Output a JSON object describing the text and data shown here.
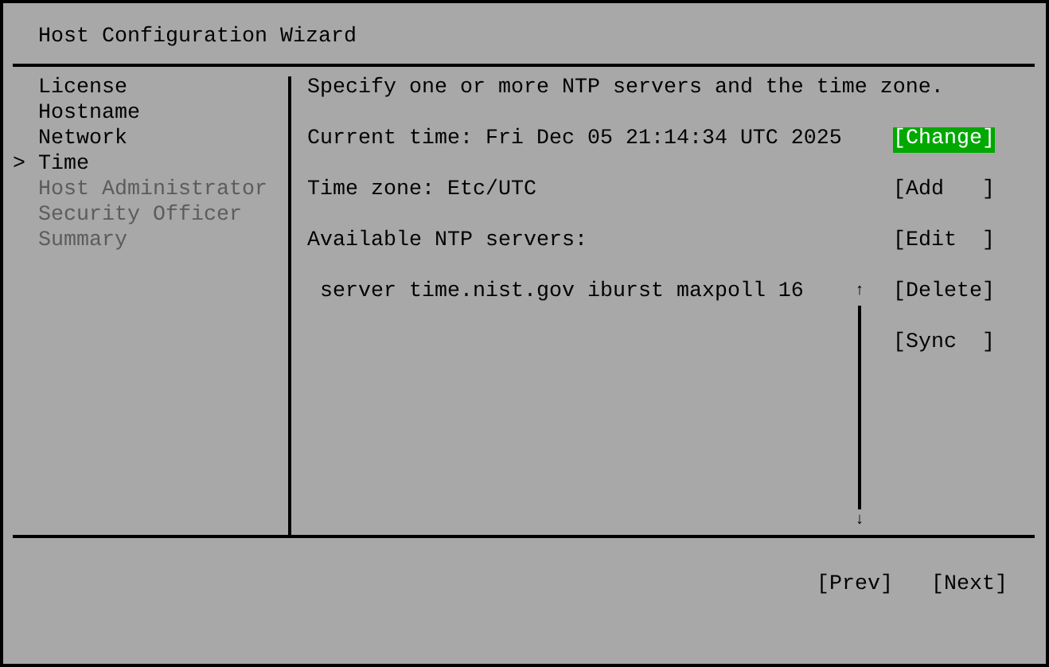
{
  "window": {
    "title": "Host Configuration Wizard"
  },
  "sidebar": {
    "marker": ">",
    "items": [
      {
        "label": "License",
        "selected": false,
        "disabled": false
      },
      {
        "label": "Hostname",
        "selected": false,
        "disabled": false
      },
      {
        "label": "Network",
        "selected": false,
        "disabled": false
      },
      {
        "label": "Time",
        "selected": true,
        "disabled": false
      },
      {
        "label": "Host Administrator",
        "selected": false,
        "disabled": true
      },
      {
        "label": "Security Officer",
        "selected": false,
        "disabled": true
      },
      {
        "label": "Summary",
        "selected": false,
        "disabled": true
      }
    ]
  },
  "content": {
    "description": "Specify one or more NTP servers and the time zone.",
    "current_time": "Current time: Fri Dec 05 21:14:34 UTC 2025",
    "time_zone": "Time zone: Etc/UTC",
    "servers_label": "Available NTP servers:",
    "servers": [
      "server time.nist.gov iburst maxpoll 16"
    ],
    "scroll_up": "↑",
    "scroll_down": "↓",
    "buttons": [
      {
        "label": "[Change]",
        "focused": true
      },
      {
        "label": "[Add   ]",
        "focused": false
      },
      {
        "label": "[Edit  ]",
        "focused": false
      },
      {
        "label": "[Delete]",
        "focused": false
      },
      {
        "label": "[Sync  ]",
        "focused": false
      }
    ]
  },
  "footer": {
    "buttons": [
      {
        "label": "[Prev]",
        "focused": false
      },
      {
        "label": "[Next]",
        "focused": false
      }
    ]
  }
}
